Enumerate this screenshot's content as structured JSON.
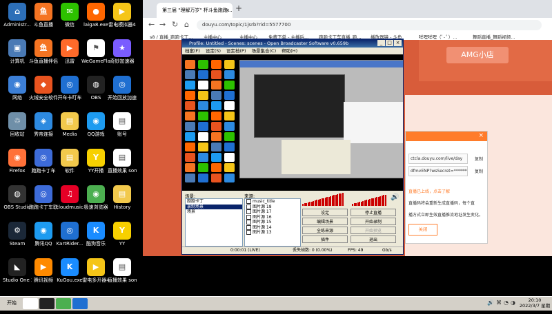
{
  "desktop": {
    "icons": [
      {
        "label": "Administr...",
        "color": "#2d6fb8",
        "glyph": "⌂"
      },
      {
        "label": "斗鱼直播",
        "color": "#f57422",
        "glyph": "鱼"
      },
      {
        "label": "微信",
        "color": "#2dc100",
        "glyph": "✉"
      },
      {
        "label": "laiga8.exe",
        "color": "#ff6600",
        "glyph": "●"
      },
      {
        "label": "雷电模拟器4",
        "color": "#f5c518",
        "glyph": "▶"
      },
      {
        "label": "计算机",
        "color": "#4a7ab5",
        "glyph": "▣"
      },
      {
        "label": "斗鱼直播伴侣",
        "color": "#f57422",
        "glyph": "鱼"
      },
      {
        "label": "迅雷",
        "color": "#ff6a2a",
        "glyph": "▶"
      },
      {
        "label": "WeGameFlag",
        "color": "#ffffff",
        "glyph": "⚑"
      },
      {
        "label": "奇妙加速器",
        "color": "#7a5cff",
        "glyph": "★"
      },
      {
        "label": "网络",
        "color": "#3c7fd6",
        "glyph": "◉"
      },
      {
        "label": "火绒安全软件",
        "color": "#e8531f",
        "glyph": "◆"
      },
      {
        "label": "开车卡叮车",
        "color": "#1f6fd1",
        "glyph": "◎"
      },
      {
        "label": "OBS",
        "color": "#222222",
        "glyph": "◍"
      },
      {
        "label": "开始回放加速器",
        "color": "#1f6fd1",
        "glyph": "◎"
      },
      {
        "label": "回收站",
        "color": "#6f8fa8",
        "glyph": "♲"
      },
      {
        "label": "秀帝连接",
        "color": "#2d8ae0",
        "glyph": "◈"
      },
      {
        "label": "Media",
        "color": "#f2c94c",
        "glyph": "▤"
      },
      {
        "label": "QQ游戏",
        "color": "#1d9bf0",
        "glyph": "◉"
      },
      {
        "label": "账号",
        "color": "#ffffff",
        "glyph": "▤"
      },
      {
        "label": "Firefox",
        "color": "#ff7139",
        "glyph": "◉"
      },
      {
        "label": "跑跑卡丁车",
        "color": "#3d6bd8",
        "glyph": "◎"
      },
      {
        "label": "软件",
        "color": "#f2c94c",
        "glyph": "▤"
      },
      {
        "label": "YY开播",
        "color": "#f7d000",
        "glyph": "Y"
      },
      {
        "label": "直播效果 song",
        "color": "#ffffff",
        "glyph": "▤"
      },
      {
        "label": "OBS Studio",
        "color": "#333333",
        "glyph": "◍"
      },
      {
        "label": "跑跑卡丁车联赛版",
        "color": "#3d6bd8",
        "glyph": "◎"
      },
      {
        "label": "cloudmusic",
        "color": "#e60026",
        "glyph": "♫"
      },
      {
        "label": "极速浏览器",
        "color": "#4caf50",
        "glyph": "◉"
      },
      {
        "label": "History",
        "color": "#f2c94c",
        "glyph": "▤"
      },
      {
        "label": "Steam",
        "color": "#1b2838",
        "glyph": "⚙"
      },
      {
        "label": "腾讯QQ",
        "color": "#1d9bf0",
        "glyph": "◉"
      },
      {
        "label": "KartRider...",
        "color": "#1f6fd1",
        "glyph": "◎"
      },
      {
        "label": "酷狗音乐",
        "color": "#1a8cff",
        "glyph": "K"
      },
      {
        "label": "YY",
        "color": "#f7d000",
        "glyph": "Y"
      },
      {
        "label": "Studio One 3",
        "color": "#222222",
        "glyph": "◣"
      },
      {
        "label": "腾讯视频",
        "color": "#ff8a00",
        "glyph": "▶"
      },
      {
        "label": "KuGou.exe",
        "color": "#1a8cff",
        "glyph": "K"
      },
      {
        "label": "雷电多开器4",
        "color": "#f5c518",
        "glyph": "▶"
      },
      {
        "label": "直播效果 song.auto...",
        "color": "#ffffff",
        "glyph": "▤"
      }
    ]
  },
  "browser": {
    "tab_title": "第三届 \"理解万岁\" 杯斗鱼跑跑...",
    "tab_close": "×",
    "new_tab": "+",
    "nav": {
      "back": "←",
      "forward": "→",
      "reload": "↻",
      "home": "⌂"
    },
    "url": "douyu.com/topic/1jsrb?rid=5577700",
    "bookmarks": [
      "s8 / 直播_跑跑卡丁...",
      "主播中心",
      "主播中心",
      "免费下单 - 主播后...",
      "跑跑卡丁车直播_跑...",
      "播放器镜 - 斗鱼",
      "咩哩咩哩（ﾟ- ﾟ）...",
      "舞蹈直播_舞蹈视频..."
    ],
    "site_badge": "AMG小店"
  },
  "popup": {
    "close": "×",
    "fields": [
      "ctcla.douyu.com/live/day",
      "dfmvENP?wsSecret=********"
    ],
    "copy": "复制",
    "lines": [
      "直播已上线，点击了解",
      "直播码将会重新生成直播码，每个直",
      "播方式立即生效直播推流地址发生变化。"
    ],
    "close_button": "关闭"
  },
  "obs": {
    "title": "Profile: Untitled - Scenes: scenes - Open Broadcaster Software v0.659b",
    "menu": [
      "档案(F)",
      "设定(S)",
      "设定档(P)",
      "场景集合(C)",
      "帮助(H)"
    ],
    "scenes_label": "场景:",
    "scenes": [
      "跑跑卡丁",
      "录制场景",
      "场景"
    ],
    "sources_label": "来源:",
    "sources": [
      "music_title",
      "图片源 18",
      "图片源 17",
      "图片源 16",
      "图片源 15",
      "图片源 14",
      "图片源 13"
    ],
    "buttons": [
      [
        "设定",
        "停止直播"
      ],
      [
        "编辑场景",
        "开始录制"
      ],
      [
        "全练来源",
        "开始预览"
      ],
      [
        "插件",
        "退出"
      ]
    ],
    "status": {
      "time": "0:00:01 (LIVE)",
      "dropped": "丢失帧数: 0 (0.00%)",
      "fps": "FPS: 49",
      "bitrate": "Gb/s"
    }
  },
  "taskbar": {
    "start": "开始",
    "tray": "🔊⌘◔◑",
    "time": "20:10",
    "date": "2022/3/7 星期一"
  }
}
